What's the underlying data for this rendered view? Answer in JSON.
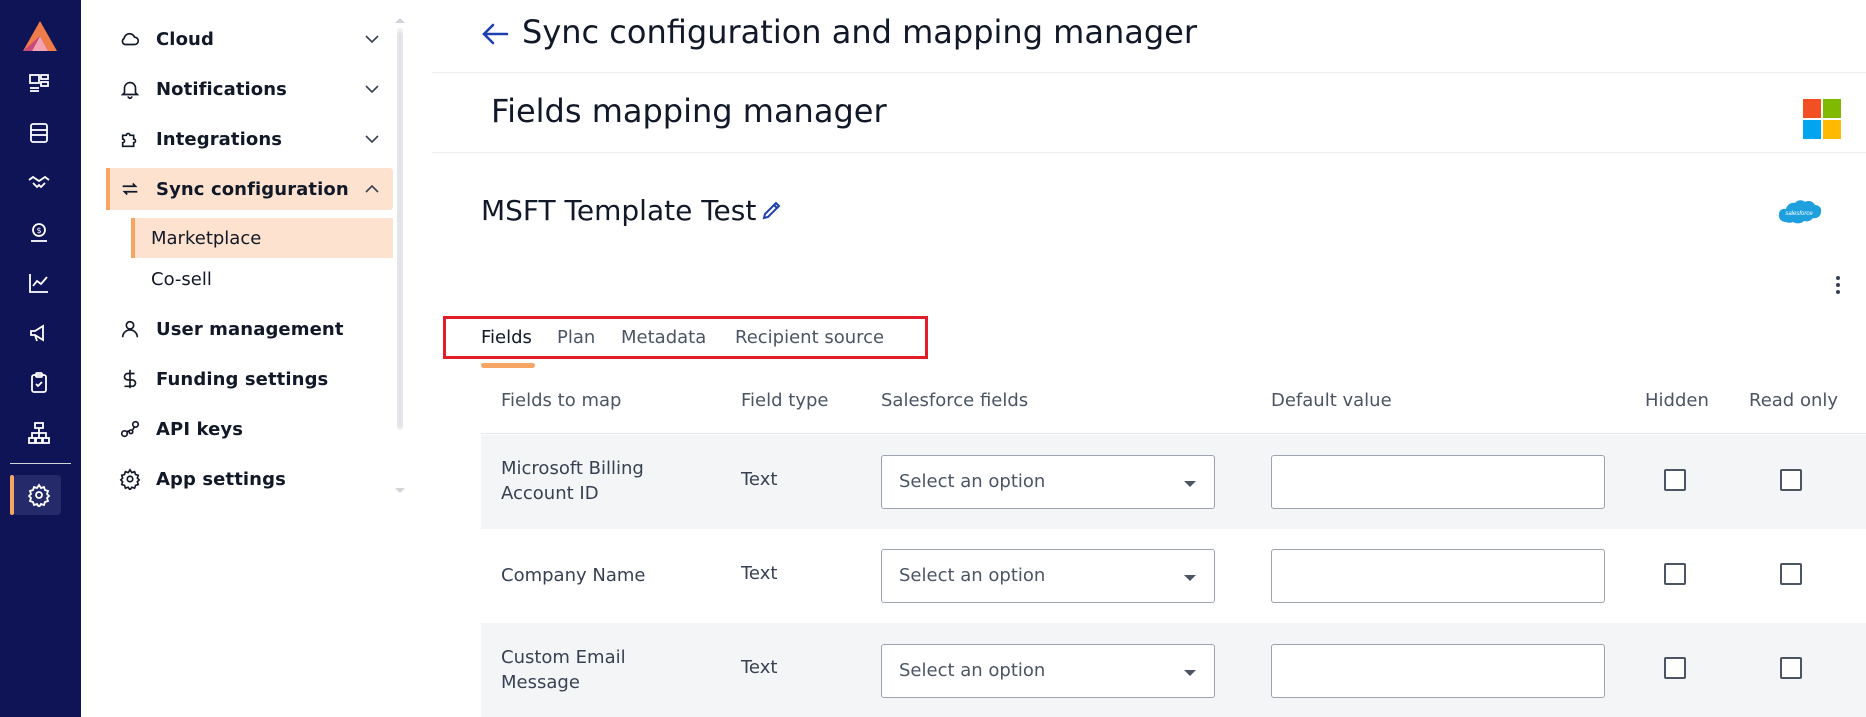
{
  "sidebar": {
    "items": [
      {
        "label": "Cloud",
        "icon": "cloud-icon"
      },
      {
        "label": "Notifications",
        "icon": "bell-icon"
      },
      {
        "label": "Integrations",
        "icon": "puzzle-icon"
      },
      {
        "label": "Sync configuration",
        "icon": "sync-icon"
      },
      {
        "label": "User management",
        "icon": "user-icon"
      },
      {
        "label": "Funding settings",
        "icon": "dollar-icon"
      },
      {
        "label": "API keys",
        "icon": "api-keys-icon"
      },
      {
        "label": "App settings",
        "icon": "gear-icon"
      }
    ],
    "sub_items": [
      "Marketplace",
      "Co-sell"
    ]
  },
  "header": {
    "title": "Sync configuration and mapping manager",
    "subtitle": "Fields mapping manager"
  },
  "template": {
    "name": "MSFT Template Test",
    "salesforce_logo_text": "salesforce"
  },
  "tabs": [
    "Fields",
    "Plan",
    "Metadata",
    "Recipient source"
  ],
  "table": {
    "headers": [
      "Fields to map",
      "Field type",
      "Salesforce fields",
      "Default value",
      "Hidden",
      "Read only"
    ],
    "rows": [
      {
        "field": "Microsoft Billing Account ID",
        "type": "Text",
        "select_value": "Select an option",
        "default_value": "",
        "hidden": false,
        "read_only": false
      },
      {
        "field": "Company Name",
        "type": "Text",
        "select_value": "Select an option",
        "default_value": "",
        "hidden": false,
        "read_only": false
      },
      {
        "field": "Custom Email Message",
        "type": "Text",
        "select_value": "Select an option",
        "default_value": "",
        "hidden": false,
        "read_only": false
      }
    ]
  },
  "colors": {
    "rail_bg": "#0f1456",
    "accent_orange": "#f7a565",
    "active_bg": "#fde3cf",
    "highlight_red": "#e11d2a",
    "back_arrow_blue": "#1e40af"
  }
}
